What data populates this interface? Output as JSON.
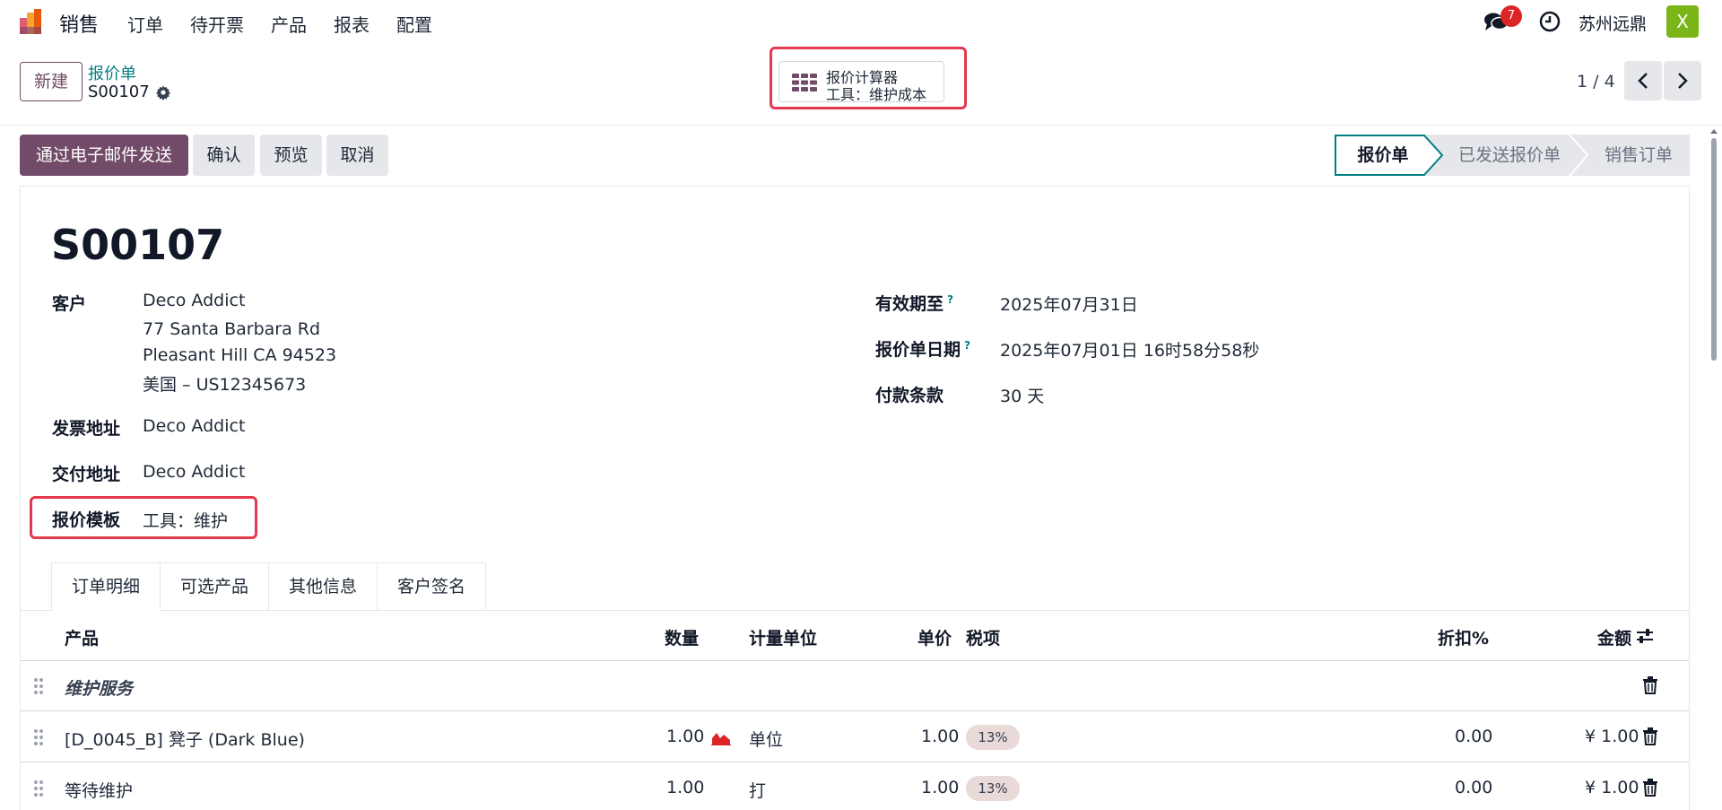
{
  "nav": {
    "app_name": "销售",
    "menu": [
      "订单",
      "待开票",
      "产品",
      "报表",
      "配置"
    ],
    "chat_badge": "7",
    "company": "苏州远鼎",
    "avatar_letter": "X"
  },
  "control": {
    "new_label": "新建",
    "breadcrumb_parent": "报价单",
    "breadcrumb_current": "S00107",
    "calc_line1": "报价计算器",
    "calc_line2": "工具：维护成本",
    "pager": "1 / 4"
  },
  "actions": {
    "send_email": "通过电子邮件发送",
    "confirm": "确认",
    "preview": "预览",
    "cancel": "取消"
  },
  "status": {
    "steps": [
      "报价单",
      "已发送报价单",
      "销售订单"
    ],
    "active": 0
  },
  "form": {
    "title": "S00107",
    "customer_label": "客户",
    "customer_name": "Deco Addict",
    "customer_addr1": "77 Santa Barbara Rd",
    "customer_addr2": "Pleasant Hill CA 94523",
    "customer_addr3": "美国 – US12345673",
    "invoice_addr_label": "发票地址",
    "invoice_addr": "Deco Addict",
    "delivery_addr_label": "交付地址",
    "delivery_addr": "Deco Addict",
    "template_label": "报价模板",
    "template_value": "工具：维护",
    "valid_until_label": "有效期至",
    "valid_until": "2025年07月31日",
    "quote_date_label": "报价单日期",
    "quote_date": "2025年07月01日 16时58分58秒",
    "payment_terms_label": "付款条款",
    "payment_terms": "30 天",
    "help_mark": "?"
  },
  "tabs": [
    "订单明细",
    "可选产品",
    "其他信息",
    "客户签名"
  ],
  "table": {
    "headers": {
      "product": "产品",
      "qty": "数量",
      "uom": "计量单位",
      "price": "单价",
      "taxes": "税项",
      "discount": "折扣%",
      "amount": "金额"
    },
    "section": "维护服务",
    "rows": [
      {
        "product": "[D_0045_B] 凳子 (Dark Blue)",
        "qty": "1.00",
        "uom": "单位",
        "price": "1.00",
        "tax": "13%",
        "discount": "0.00",
        "amount": "¥ 1.00"
      },
      {
        "product": "等待维护",
        "qty": "1.00",
        "uom": "打",
        "price": "1.00",
        "tax": "13%",
        "discount": "0.00",
        "amount": "¥ 1.00"
      }
    ]
  },
  "colors": {
    "primary": "#714b67",
    "link": "#017e84",
    "highlight": "#e5394f",
    "avatar": "#7cb518",
    "badge": "#dc2626"
  }
}
